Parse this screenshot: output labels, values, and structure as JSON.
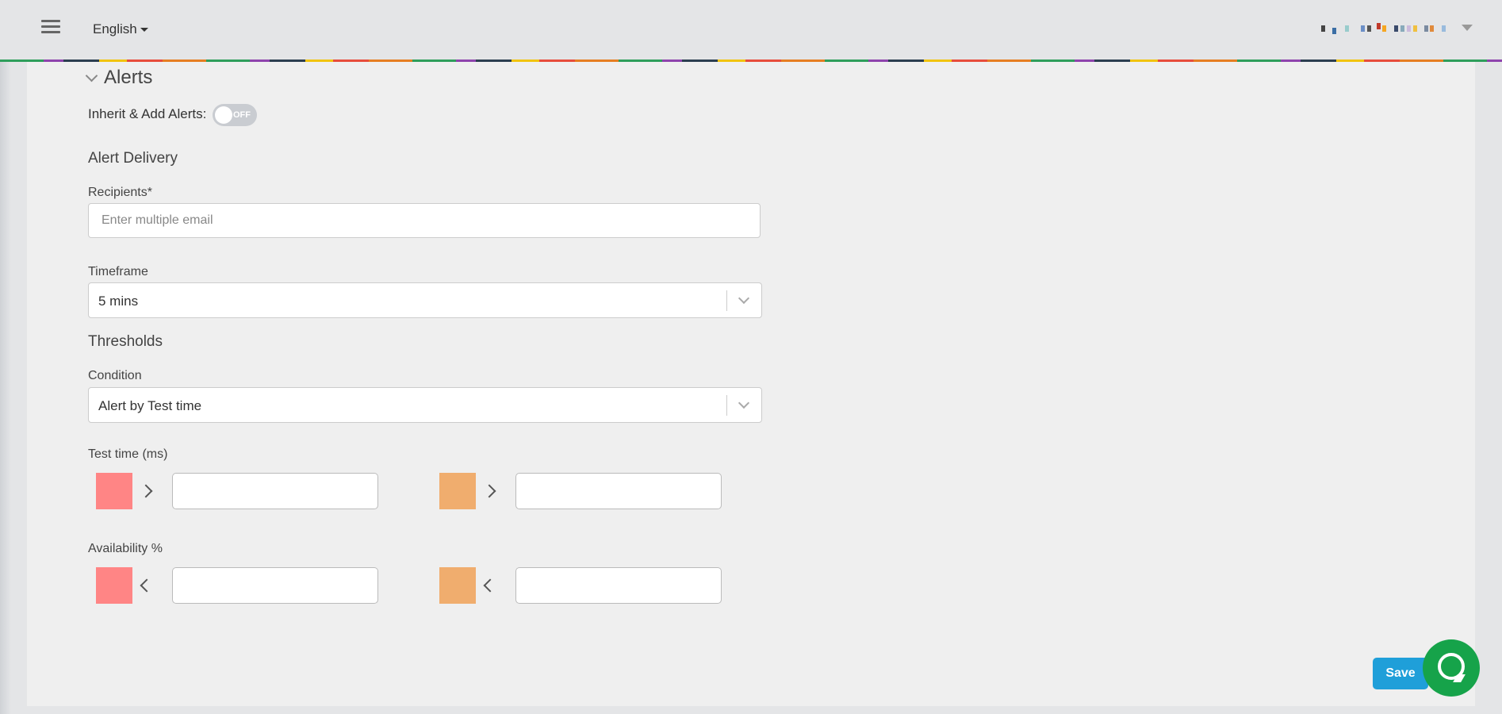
{
  "header": {
    "language": "English"
  },
  "alerts": {
    "section_title": "Alerts",
    "inherit_label": "Inherit & Add Alerts:",
    "inherit_toggle": "OFF",
    "delivery_title": "Alert Delivery",
    "recipients_label": "Recipients*",
    "recipients_placeholder": "Enter multiple email",
    "recipients_value": "",
    "timeframe_label": "Timeframe",
    "timeframe_value": "5 mins",
    "thresholds_title": "Thresholds",
    "condition_label": "Condition",
    "condition_value": "Alert by Test time",
    "test_time_label": "Test time (ms)",
    "availability_label": "Availability %",
    "colors": {
      "critical": "#ff8585",
      "warning": "#f0ad6e"
    }
  },
  "footer": {
    "save_label": "Save"
  }
}
